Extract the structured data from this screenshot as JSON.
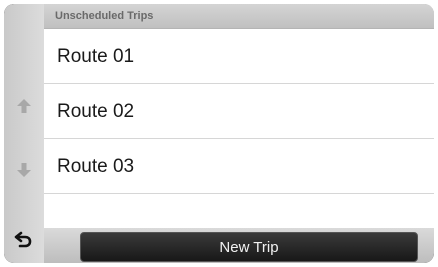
{
  "header": {
    "title": "Unscheduled Trips"
  },
  "routes": [
    {
      "label": "Route 01"
    },
    {
      "label": "Route 02"
    },
    {
      "label": "Route 03"
    }
  ],
  "actions": {
    "new_trip_label": "New Trip"
  },
  "icons": {
    "scroll_up": "up-arrow-icon",
    "scroll_down": "down-arrow-icon",
    "back": "back-arrow-icon"
  },
  "colors": {
    "rail": "#d0d0d0",
    "arrow": "#a8a8a8",
    "button": "#222222",
    "button_text": "#f2f2f2"
  }
}
